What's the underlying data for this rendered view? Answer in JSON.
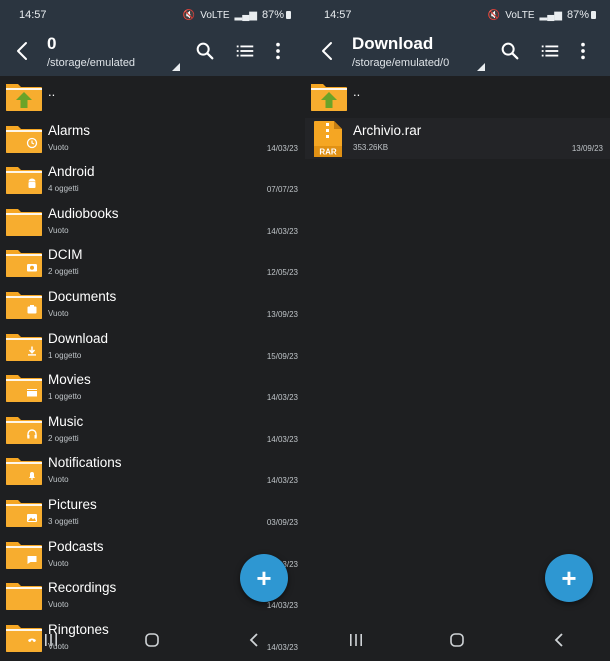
{
  "left": {
    "status": {
      "time": "14:57",
      "network": "VoLTE",
      "battery": "87%"
    },
    "header": {
      "title": "0",
      "path": "/storage/emulated"
    },
    "items": [
      {
        "name": "..",
        "meta": "",
        "date": "",
        "icon": "parent-folder-icon"
      },
      {
        "name": "Alarms",
        "meta": "Vuoto",
        "date": "14/03/23",
        "icon": "alarm-folder-icon"
      },
      {
        "name": "Android",
        "meta": "4 oggetti",
        "date": "07/07/23",
        "icon": "android-folder-icon"
      },
      {
        "name": "Audiobooks",
        "meta": "Vuoto",
        "date": "14/03/23",
        "icon": "folder-icon"
      },
      {
        "name": "DCIM",
        "meta": "2 oggetti",
        "date": "12/05/23",
        "icon": "camera-folder-icon"
      },
      {
        "name": "Documents",
        "meta": "Vuoto",
        "date": "13/09/23",
        "icon": "documents-folder-icon"
      },
      {
        "name": "Download",
        "meta": "1 oggetto",
        "date": "15/09/23",
        "icon": "download-folder-icon"
      },
      {
        "name": "Movies",
        "meta": "1 oggetto",
        "date": "14/03/23",
        "icon": "movie-folder-icon"
      },
      {
        "name": "Music",
        "meta": "2 oggetti",
        "date": "14/03/23",
        "icon": "music-folder-icon"
      },
      {
        "name": "Notifications",
        "meta": "Vuoto",
        "date": "14/03/23",
        "icon": "bell-folder-icon"
      },
      {
        "name": "Pictures",
        "meta": "3 oggetti",
        "date": "03/09/23",
        "icon": "image-folder-icon"
      },
      {
        "name": "Podcasts",
        "meta": "Vuoto",
        "date": "14/03/23",
        "icon": "chat-folder-icon"
      },
      {
        "name": "Recordings",
        "meta": "Vuoto",
        "date": "14/03/23",
        "icon": "folder-icon"
      },
      {
        "name": "Ringtones",
        "meta": "Vuoto",
        "date": "14/03/23",
        "icon": "phone-folder-icon"
      }
    ]
  },
  "right": {
    "status": {
      "time": "14:57",
      "network": "VoLTE",
      "battery": "87%"
    },
    "header": {
      "title": "Download",
      "path": "/storage/emulated/0"
    },
    "items": [
      {
        "name": "..",
        "meta": "",
        "date": "",
        "icon": "parent-folder-icon"
      },
      {
        "name": "Archivio.rar",
        "meta": "353.26KB",
        "date": "13/09/23",
        "icon": "rar-file-icon",
        "badge": "RAR"
      }
    ]
  },
  "fab_label": "+",
  "colors": {
    "appbar": "#2b3540",
    "background": "#1e1f21",
    "folder": "#f5a623",
    "fab": "#2e97d2",
    "up_arrow": "#6aa329"
  }
}
